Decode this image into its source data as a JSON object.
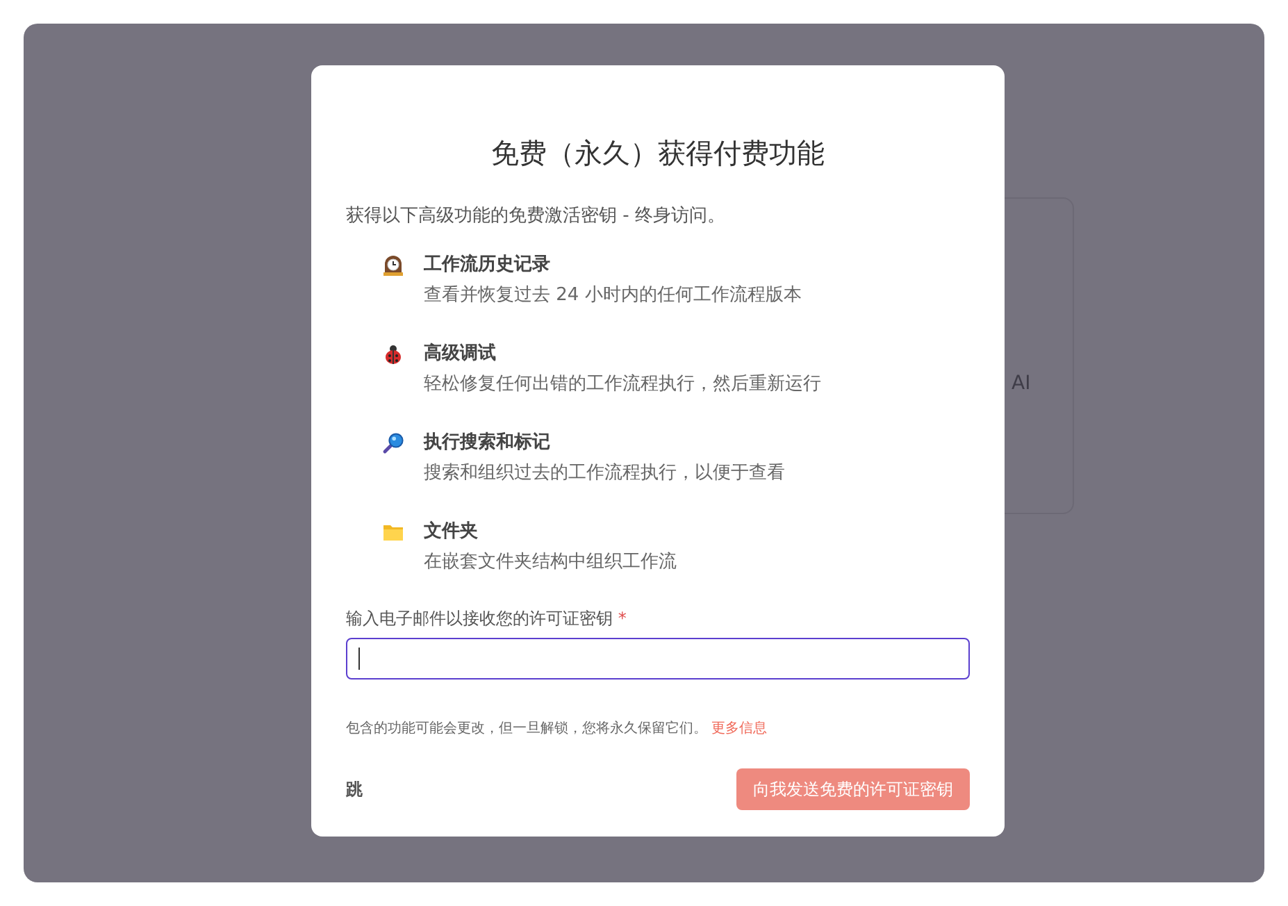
{
  "background": {
    "card_text": "AI"
  },
  "dialog": {
    "title": "免费（永久）获得付费功能",
    "subtitle": "获得以下高级功能的免费激活密钥 - 终身访问。",
    "features": [
      {
        "title": "工作流历史记录",
        "description": "查看并恢复过去 24 小时内的任何工作流程版本"
      },
      {
        "title": "高级调试",
        "description": "轻松修复任何出错的工作流程执行，然后重新运行"
      },
      {
        "title": "执行搜索和标记",
        "description": "搜索和组织过去的工作流程执行，以便于查看"
      },
      {
        "title": "文件夹",
        "description": "在嵌套文件夹结构中组织工作流"
      }
    ],
    "email_field": {
      "label": "输入电子邮件以接收您的许可证密钥",
      "required_mark": "*",
      "focused": true
    },
    "note": "包含的功能可能会更改，但一旦解锁，您将永久保留它们。",
    "more_link": "更多信息",
    "skip_button": "跳",
    "send_button": {
      "label": "向我发送免费的许可证密钥",
      "disabled": true
    }
  }
}
